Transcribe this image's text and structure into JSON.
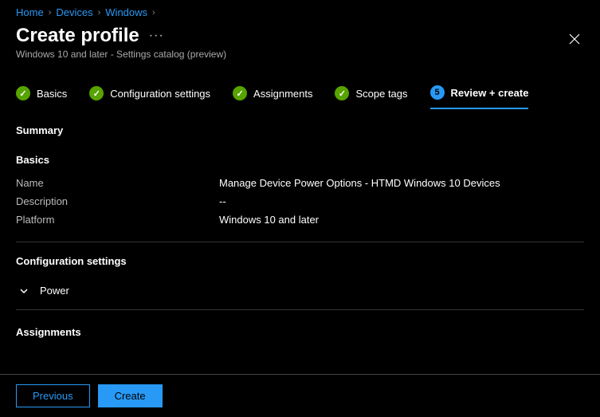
{
  "breadcrumb": [
    "Home",
    "Devices",
    "Windows"
  ],
  "header": {
    "title": "Create profile",
    "subtitle": "Windows 10 and later - Settings catalog (preview)"
  },
  "tabs": [
    {
      "label": "Basics",
      "status": "check"
    },
    {
      "label": "Configuration settings",
      "status": "check"
    },
    {
      "label": "Assignments",
      "status": "check"
    },
    {
      "label": "Scope tags",
      "status": "check"
    },
    {
      "label": "Review + create",
      "status": "5",
      "active": true
    }
  ],
  "summary": {
    "title": "Summary",
    "basics": {
      "title": "Basics",
      "rows": [
        {
          "label": "Name",
          "value": "Manage Device Power Options - HTMD Windows 10 Devices"
        },
        {
          "label": "Description",
          "value": "--"
        },
        {
          "label": "Platform",
          "value": "Windows 10 and later"
        }
      ]
    },
    "config": {
      "title": "Configuration settings",
      "item": "Power"
    },
    "assignments": {
      "title": "Assignments"
    }
  },
  "footer": {
    "previous": "Previous",
    "create": "Create"
  }
}
